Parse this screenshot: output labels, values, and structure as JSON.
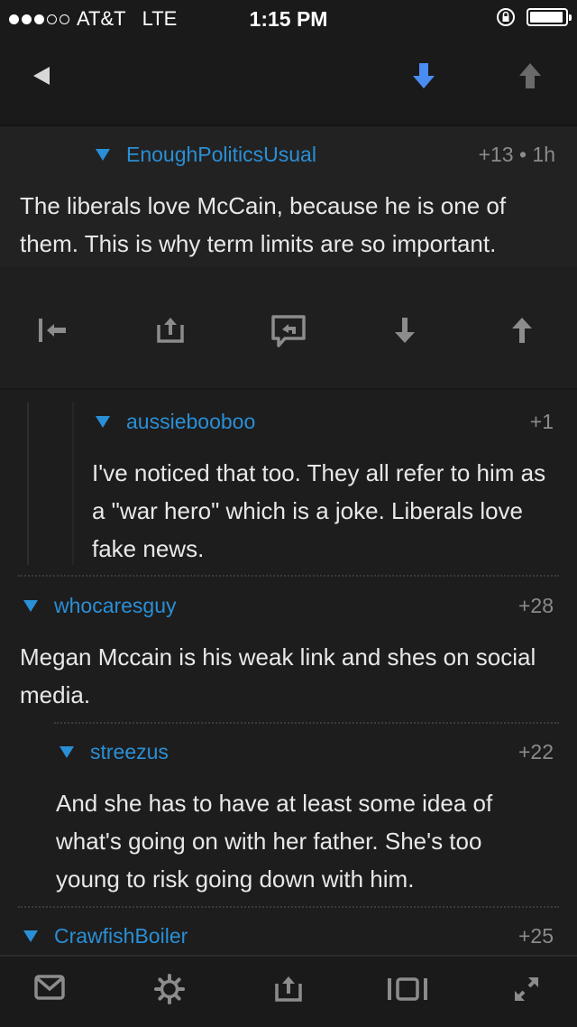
{
  "status_bar": {
    "signal_dots_filled": 3,
    "signal_dots_total": 5,
    "carrier": "AT&T",
    "network": "LTE",
    "time": "1:15 PM",
    "rotation_lock_icon": "rotation-lock-icon",
    "battery_level": 0.9
  },
  "top_nav": {
    "back_icon": "back-triangle-icon",
    "downvote_icon": "downvote-arrow-icon",
    "upvote_icon": "upvote-arrow-icon",
    "downvote_active_color": "#4a8cf0"
  },
  "comments": [
    {
      "author": "EnoughPoliticsUsual",
      "meta": "+13 • 1h",
      "body": "The liberals love McCain, because he is one of them. This is why term limits are so important."
    },
    {
      "author": "aussiebooboo",
      "meta": "+1",
      "body": "I've noticed that too. They all refer to him as a \"war hero\" which is a joke. Liberals love fake news."
    },
    {
      "author": "whocaresguy",
      "meta": "+28",
      "body": "Megan Mccain is his weak link and shes on social media."
    },
    {
      "author": "streezus",
      "meta": "+22",
      "body": "And she has to have at least some idea of what's going on with her father. She's too young to risk going down with him."
    },
    {
      "author": "CrawfishBoiler",
      "meta": "+25"
    }
  ],
  "action_bar": {
    "icons": [
      "collapse-to-parent-icon",
      "share-icon",
      "reply-icon",
      "downvote-icon",
      "upvote-icon"
    ]
  },
  "bottom_bar": {
    "icons": [
      "mail-icon",
      "gear-icon",
      "share-icon",
      "card-view-icon",
      "expand-icon"
    ]
  },
  "colors": {
    "background": "#1d1d1d",
    "author_blue": "#2a8fd6",
    "meta_gray": "#8b8b8b",
    "icon_gray": "#8c8c8c"
  }
}
